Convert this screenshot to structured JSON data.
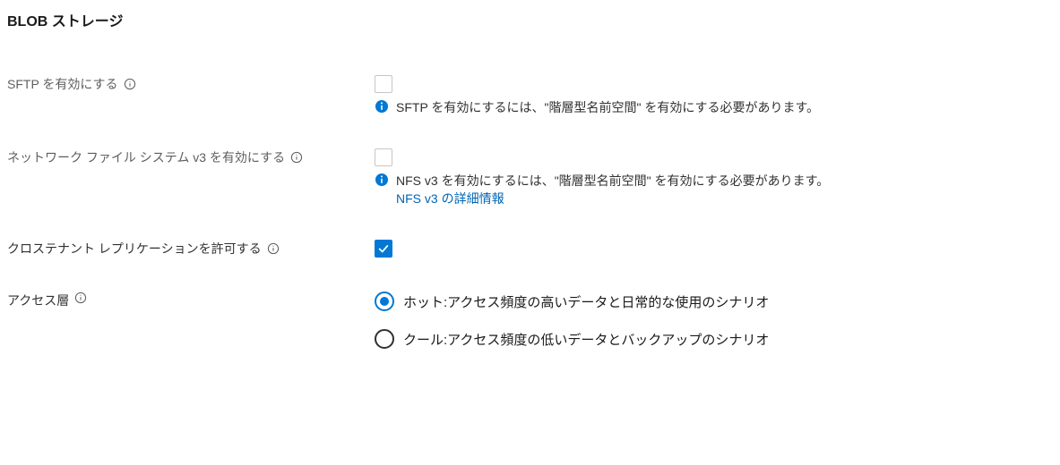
{
  "section": {
    "title": "BLOB ストレージ"
  },
  "sftp": {
    "label": "SFTP を有効にする",
    "note": "SFTP を有効にするには、\"階層型名前空間\" を有効にする必要があります。"
  },
  "nfs": {
    "label": "ネットワーク ファイル システム v3 を有効にする",
    "note": "NFS v3 を有効にするには、\"階層型名前空間\" を有効にする必要があります。",
    "link": "NFS v3 の詳細情報"
  },
  "crossTenant": {
    "label": "クロステナント レプリケーションを許可する"
  },
  "accessTier": {
    "label": "アクセス層",
    "options": {
      "hot": "ホット:アクセス頻度の高いデータと日常的な使用のシナリオ",
      "cool": "クール:アクセス頻度の低いデータとバックアップのシナリオ"
    }
  }
}
